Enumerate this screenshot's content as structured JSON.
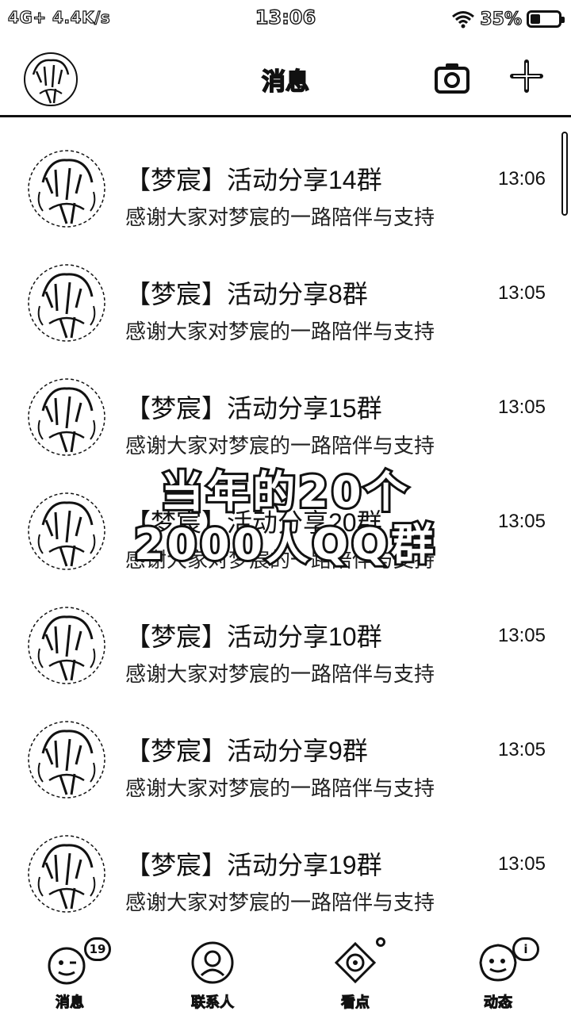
{
  "status_bar": {
    "network": "4G+ 4.4K/s",
    "time": "13:06",
    "battery_text": "35%",
    "battery_level": 0.35
  },
  "header": {
    "title": "消息",
    "camera_icon": "camera-icon",
    "plus_icon": "plus-icon"
  },
  "messages": [
    {
      "name": "【梦宸】活动分享14群",
      "preview": "感谢大家对梦宸的一路陪伴与支持",
      "time": "13:06"
    },
    {
      "name": "【梦宸】活动分享8群",
      "preview": "感谢大家对梦宸的一路陪伴与支持",
      "time": "13:05"
    },
    {
      "name": "【梦宸】活动分享15群",
      "preview": "感谢大家对梦宸的一路陪伴与支持",
      "time": "13:05"
    },
    {
      "name": "【梦宸】活动分享20群",
      "preview": "感谢大家对梦宸的一路陪伴与支持",
      "time": "13:05"
    },
    {
      "name": "【梦宸】活动分享10群",
      "preview": "感谢大家对梦宸的一路陪伴与支持",
      "time": "13:05"
    },
    {
      "name": "【梦宸】活动分享9群",
      "preview": "感谢大家对梦宸的一路陪伴与支持",
      "time": "13:05"
    },
    {
      "name": "【梦宸】活动分享19群",
      "preview": "感谢大家对梦宸的一路陪伴与支持",
      "time": "13:05"
    }
  ],
  "overlay": {
    "line1": "当年的20个",
    "line2": "2000人QQ群"
  },
  "bottom_nav": [
    {
      "label": "消息",
      "icon": "chat-face-icon",
      "badge": "19",
      "active": true
    },
    {
      "label": "联系人",
      "icon": "contacts-icon"
    },
    {
      "label": "看点",
      "icon": "eye-icon",
      "dot": true
    },
    {
      "label": "动态",
      "icon": "star-face-icon",
      "badge": "i"
    }
  ]
}
